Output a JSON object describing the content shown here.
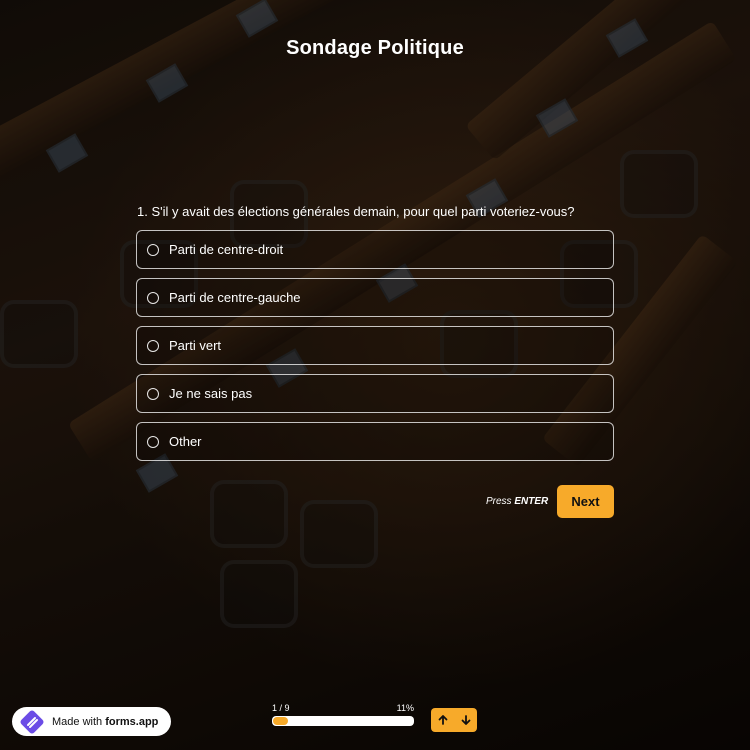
{
  "form": {
    "title": "Sondage Politique",
    "question": {
      "number": "1.",
      "text": "S'il y avait des élections générales demain, pour quel parti voteriez-vous?"
    },
    "options": [
      {
        "label": "Parti de centre-droit"
      },
      {
        "label": "Parti de centre-gauche"
      },
      {
        "label": "Parti vert"
      },
      {
        "label": "Je ne sais pas"
      },
      {
        "label": "Other"
      }
    ],
    "press_hint_prefix": "Press ",
    "press_hint_key": "ENTER",
    "next_label": "Next"
  },
  "footer": {
    "badge_prefix": "Made with ",
    "badge_brand": "forms.app",
    "progress_label": "1 / 9",
    "progress_percent_label": "11%",
    "progress_fraction": 0.11
  },
  "colors": {
    "accent": "#f7aa2a",
    "brand": "#6b4ce6"
  },
  "icons": {
    "up": "arrow-up-icon",
    "down": "arrow-down-icon",
    "logo": "forms-app-logo"
  }
}
